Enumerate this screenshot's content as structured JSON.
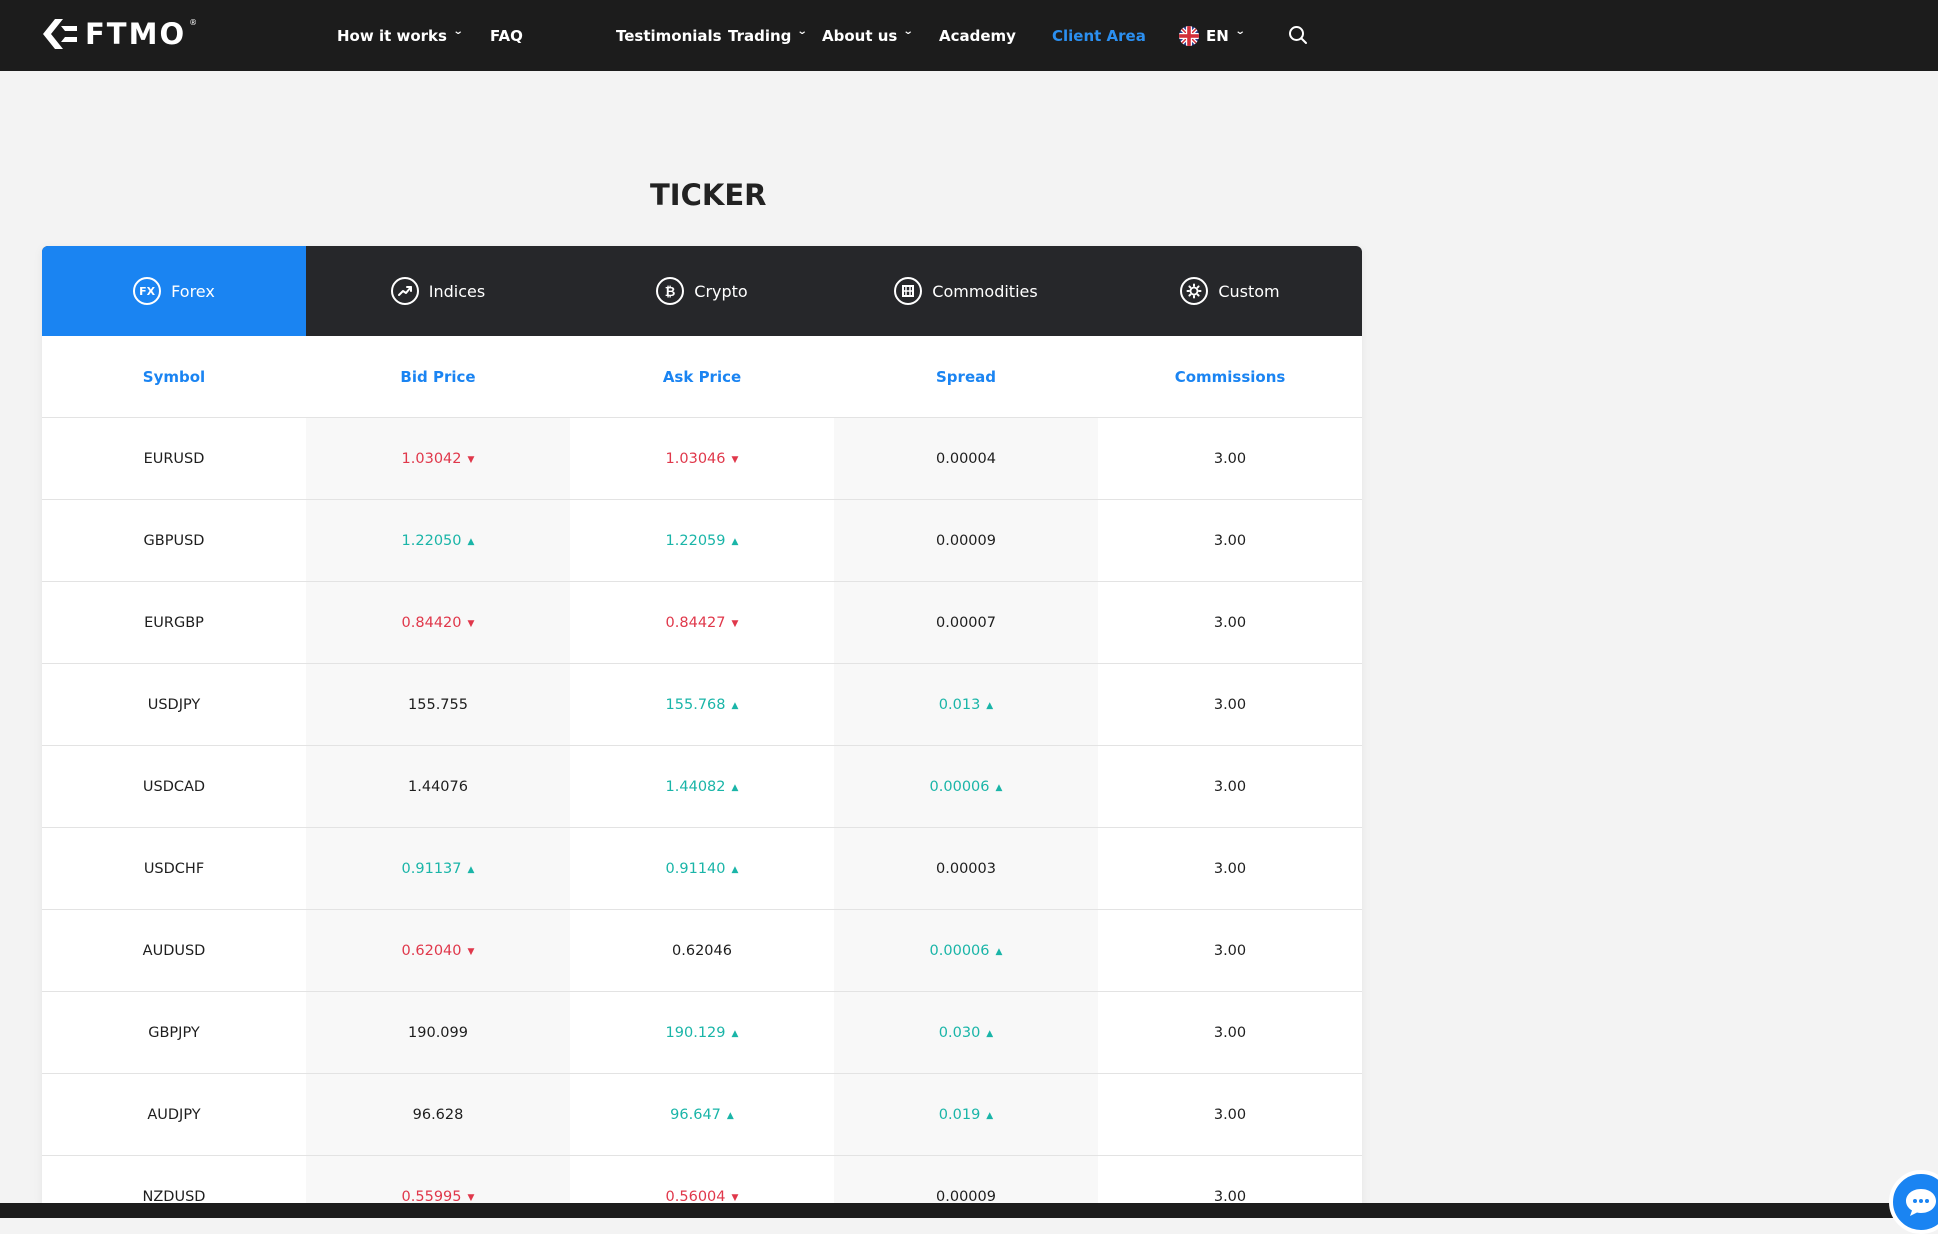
{
  "brand": {
    "name": "FTMO",
    "reg": "®"
  },
  "nav": {
    "items": [
      {
        "label": "How it works",
        "dropdown": true
      },
      {
        "label": "FAQ",
        "dropdown": false
      },
      {
        "label": "Testimonials",
        "dropdown": false
      },
      {
        "label": "Trading",
        "dropdown": true
      },
      {
        "label": "About us",
        "dropdown": true
      },
      {
        "label": "Academy",
        "dropdown": false
      },
      {
        "label": "Client Area",
        "dropdown": false,
        "active": true
      }
    ],
    "language": "EN",
    "search_icon": "search-icon"
  },
  "page": {
    "title": "TICKER"
  },
  "tabs": [
    {
      "label": "Forex",
      "icon": "fx-icon",
      "icon_text": "FX",
      "active": true
    },
    {
      "label": "Indices",
      "icon": "trend-up-icon"
    },
    {
      "label": "Crypto",
      "icon": "bitcoin-icon"
    },
    {
      "label": "Commodities",
      "icon": "commodity-icon"
    },
    {
      "label": "Custom",
      "icon": "gear-icon"
    }
  ],
  "table": {
    "columns": [
      "Symbol",
      "Bid Price",
      "Ask Price",
      "Spread",
      "Commissions"
    ],
    "rows": [
      {
        "symbol": "EURUSD",
        "bid": "1.03042",
        "bid_dir": "down",
        "ask": "1.03046",
        "ask_dir": "down",
        "spread": "0.00004",
        "spread_dir": "",
        "commission": "3.00"
      },
      {
        "symbol": "GBPUSD",
        "bid": "1.22050",
        "bid_dir": "up",
        "ask": "1.22059",
        "ask_dir": "up",
        "spread": "0.00009",
        "spread_dir": "",
        "commission": "3.00"
      },
      {
        "symbol": "EURGBP",
        "bid": "0.84420",
        "bid_dir": "down",
        "ask": "0.84427",
        "ask_dir": "down",
        "spread": "0.00007",
        "spread_dir": "",
        "commission": "3.00"
      },
      {
        "symbol": "USDJPY",
        "bid": "155.755",
        "bid_dir": "",
        "ask": "155.768",
        "ask_dir": "up",
        "spread": "0.013",
        "spread_dir": "up",
        "commission": "3.00"
      },
      {
        "symbol": "USDCAD",
        "bid": "1.44076",
        "bid_dir": "",
        "ask": "1.44082",
        "ask_dir": "up",
        "spread": "0.00006",
        "spread_dir": "up",
        "commission": "3.00"
      },
      {
        "symbol": "USDCHF",
        "bid": "0.91137",
        "bid_dir": "up",
        "ask": "0.91140",
        "ask_dir": "up",
        "spread": "0.00003",
        "spread_dir": "",
        "commission": "3.00"
      },
      {
        "symbol": "AUDUSD",
        "bid": "0.62040",
        "bid_dir": "down",
        "ask": "0.62046",
        "ask_dir": "",
        "spread": "0.00006",
        "spread_dir": "up",
        "commission": "3.00"
      },
      {
        "symbol": "GBPJPY",
        "bid": "190.099",
        "bid_dir": "",
        "ask": "190.129",
        "ask_dir": "up",
        "spread": "0.030",
        "spread_dir": "up",
        "commission": "3.00"
      },
      {
        "symbol": "AUDJPY",
        "bid": "96.628",
        "bid_dir": "",
        "ask": "96.647",
        "ask_dir": "up",
        "spread": "0.019",
        "spread_dir": "up",
        "commission": "3.00"
      },
      {
        "symbol": "NZDUSD",
        "bid": "0.55995",
        "bid_dir": "down",
        "ask": "0.56004",
        "ask_dir": "down",
        "spread": "0.00009",
        "spread_dir": "",
        "commission": "3.00"
      }
    ]
  },
  "colors": {
    "accent": "#1a84f2",
    "up": "#1ab5a8",
    "down": "#e0384b",
    "nav_bg": "#1c1c1c",
    "tabs_bg": "#26272a"
  },
  "chat": {
    "icon": "chat-bubble-icon"
  }
}
